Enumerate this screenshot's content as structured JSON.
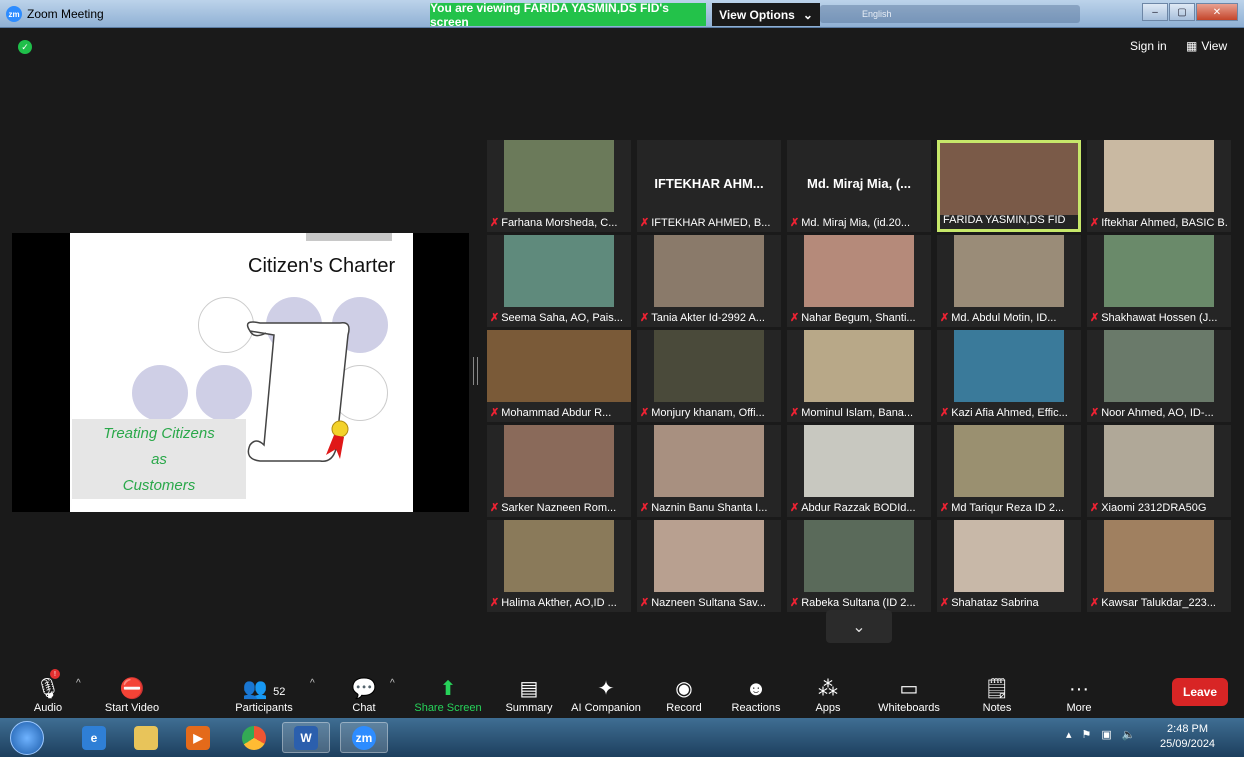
{
  "window": {
    "title": "Zoom Meeting",
    "app_badge": "zm",
    "share_banner": "You are viewing FARIDA YASMIN,DS FID's screen",
    "view_options": "View Options",
    "language": "English"
  },
  "header": {
    "sign_in": "Sign in",
    "view": "View"
  },
  "slide": {
    "title": "Citizen's Charter",
    "caption_lines": [
      "Treating Citizens",
      "as",
      "Customers"
    ]
  },
  "gallery": [
    {
      "name": "Farhana Morsheda, C...",
      "color": "#6b7a5a"
    },
    {
      "name": "IFTEKHAR AHMED, B...",
      "bigname": "IFTEKHAR AHM..."
    },
    {
      "name": "Md. Miraj Mia, (id.20...",
      "bigname": "Md. Miraj Mia, (..."
    },
    {
      "name": "FARIDA YASMIN,DS FID",
      "color": "#7a5a48",
      "active": true
    },
    {
      "name": "Iftekhar Ahmed, BASIC B...",
      "color": "#c9b9a2"
    },
    {
      "name": "Seema Saha, AO, Pais...",
      "color": "#5f8a7c"
    },
    {
      "name": "Tania Akter Id-2992 A...",
      "color": "#8a7a6a"
    },
    {
      "name": "Nahar Begum, Shanti...",
      "color": "#b58a7a"
    },
    {
      "name": "Md. Abdul Motin,  ID...",
      "color": "#9a8c78"
    },
    {
      "name": "Shakhawat Hossen (J...",
      "color": "#6a8a6a"
    },
    {
      "name": "Mohammad Abdur R...",
      "color": "#7a5a38"
    },
    {
      "name": "Monjury khanam, Offi...",
      "color": "#4a4a3a"
    },
    {
      "name": "Mominul Islam, Bana...",
      "color": "#b8a888"
    },
    {
      "name": "Kazi Afia Ahmed, Effic...",
      "color": "#3a7a9a"
    },
    {
      "name": "Noor Ahmed, AO, ID-...",
      "color": "#6a7a6a"
    },
    {
      "name": "Sarker Nazneen Rom...",
      "color": "#8a6a5a"
    },
    {
      "name": "Naznin Banu Shanta I...",
      "color": "#a89080"
    },
    {
      "name": "Abdur Razzak BODId...",
      "color": "#c8c8c0"
    },
    {
      "name": "Md Tariqur Reza ID 2...",
      "color": "#9a9070"
    },
    {
      "name": "Xiaomi 2312DRA50G",
      "color": "#b0a898"
    },
    {
      "name": "Halima Akther, AO,ID ...",
      "color": "#8a7a5a"
    },
    {
      "name": "Nazneen  Sultana Sav...",
      "color": "#b8a090"
    },
    {
      "name": "Rabeka Sultana (ID 2...",
      "color": "#5a6a5a"
    },
    {
      "name": "Shahataz Sabrina",
      "color": "#c8b8a8"
    },
    {
      "name": "Kawsar Talukdar_223...",
      "color": "#a08060"
    }
  ],
  "toolbar": {
    "audio": "Audio",
    "start_video": "Start Video",
    "participants": "Participants",
    "participant_count": "52",
    "chat": "Chat",
    "share_screen": "Share Screen",
    "summary": "Summary",
    "ai_companion": "AI Companion",
    "record": "Record",
    "reactions": "Reactions",
    "apps": "Apps",
    "whiteboards": "Whiteboards",
    "notes": "Notes",
    "more": "More",
    "leave": "Leave"
  },
  "taskbar": {
    "time": "2:48 PM",
    "date": "25/09/2024",
    "zoom_label": "zm"
  },
  "colors": {
    "share_green": "#23c24a",
    "leave_red": "#d82525",
    "active_border": "#c7e86a"
  }
}
